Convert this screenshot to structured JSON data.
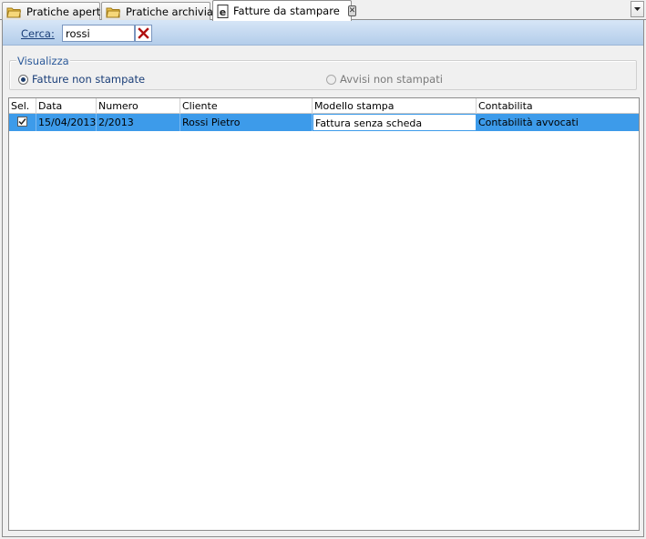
{
  "tabs": [
    {
      "label": "Pratiche aperte",
      "icon": "folder-icon"
    },
    {
      "label": "Pratiche archiviate",
      "icon": "folder-icon"
    },
    {
      "label": "Fatture da stampare",
      "icon": "document-e-icon"
    }
  ],
  "search": {
    "label": "Cerca:",
    "value": "rossi"
  },
  "view_group": {
    "legend": "Visualizza",
    "options": [
      {
        "label": "Fatture non stampate",
        "selected": true
      },
      {
        "label": "Avvisi non stampati",
        "selected": false
      }
    ]
  },
  "grid": {
    "columns": [
      "Sel.",
      "Data",
      "Numero",
      "Cliente",
      "Modello stampa",
      "Contabilita"
    ],
    "rows": [
      {
        "sel": true,
        "data": "15/04/2013",
        "numero": "2/2013",
        "cliente": "Rossi Pietro",
        "modello": "Fattura senza scheda",
        "contabilita": "Contabilità avvocati"
      }
    ]
  },
  "colors": {
    "selection": "#3d9bea",
    "search_bar": "#b3cdea",
    "accent_text": "#1a3e78"
  }
}
